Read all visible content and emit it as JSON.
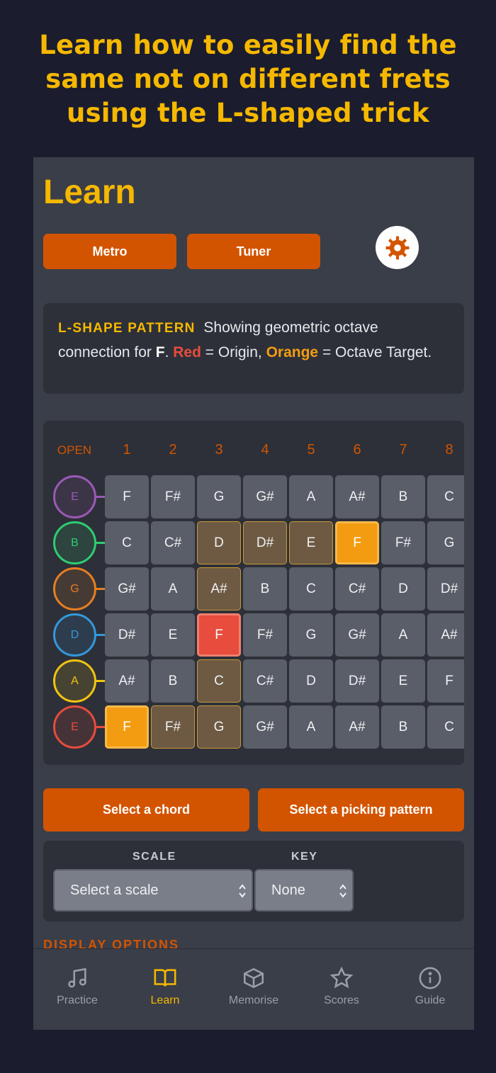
{
  "promo": {
    "line1": "Learn how to easily find the",
    "line2": "same not on different frets",
    "line3": "using the L-shaped trick"
  },
  "header": {
    "title": "Learn"
  },
  "toolbar": {
    "metro_label": "Metro",
    "tuner_label": "Tuner",
    "settings_icon": "gear-icon"
  },
  "info": {
    "tag": "L-SHAPE PATTERN",
    "text1": " Showing geometric octave connection for ",
    "note": "F",
    "text2": ". ",
    "red": "Red",
    "text3": " = Origin, ",
    "orange": "Orange",
    "text4": " = Octave Target."
  },
  "fretboard": {
    "frets": [
      "OPEN",
      "1",
      "2",
      "3",
      "4",
      "5",
      "6",
      "7",
      "8"
    ],
    "strings": [
      {
        "name": "E",
        "color": "#9b59b6",
        "notes": [
          "F",
          "F#",
          "G",
          "G#",
          "A",
          "A#",
          "B",
          "C"
        ],
        "states": [
          "",
          "",
          "",
          "",
          "",
          "",
          "",
          ""
        ]
      },
      {
        "name": "B",
        "color": "#2ecc71",
        "notes": [
          "C",
          "C#",
          "D",
          "D#",
          "E",
          "F",
          "F#",
          "G"
        ],
        "states": [
          "",
          "",
          "shape",
          "shape",
          "shape",
          "target",
          "",
          ""
        ]
      },
      {
        "name": "G",
        "color": "#e67e22",
        "notes": [
          "G#",
          "A",
          "A#",
          "B",
          "C",
          "C#",
          "D",
          "D#"
        ],
        "states": [
          "",
          "",
          "shape",
          "",
          "",
          "",
          "",
          ""
        ]
      },
      {
        "name": "D",
        "color": "#3498db",
        "notes": [
          "D#",
          "E",
          "F",
          "F#",
          "G",
          "G#",
          "A",
          "A#"
        ],
        "states": [
          "",
          "",
          "origin",
          "",
          "",
          "",
          "",
          ""
        ]
      },
      {
        "name": "A",
        "color": "#f1c40f",
        "notes": [
          "A#",
          "B",
          "C",
          "C#",
          "D",
          "D#",
          "E",
          "F"
        ],
        "states": [
          "",
          "",
          "shape",
          "",
          "",
          "",
          "",
          ""
        ]
      },
      {
        "name": "E",
        "color": "#e74c3c",
        "notes": [
          "F",
          "F#",
          "G",
          "G#",
          "A",
          "A#",
          "B",
          "C"
        ],
        "states": [
          "target",
          "shape",
          "shape",
          "",
          "",
          "",
          "",
          ""
        ]
      }
    ]
  },
  "actions": {
    "chord_label": "Select a chord",
    "picking_label": "Select a picking pattern"
  },
  "scale": {
    "scale_label": "SCALE",
    "key_label": "KEY",
    "scale_value": "Select a scale",
    "key_value": "None"
  },
  "display_options": {
    "label": "DISPLAY OPTIONS"
  },
  "tabs": [
    {
      "label": "Practice",
      "icon": "music-note-icon"
    },
    {
      "label": "Learn",
      "icon": "book-icon"
    },
    {
      "label": "Memorise",
      "icon": "cube-icon"
    },
    {
      "label": "Scores",
      "icon": "star-icon"
    },
    {
      "label": "Guide",
      "icon": "info-icon"
    }
  ],
  "colors": {
    "accent": "#d35400",
    "highlight": "#f5b800",
    "origin": "#e74c3c",
    "target": "#f39c12"
  }
}
